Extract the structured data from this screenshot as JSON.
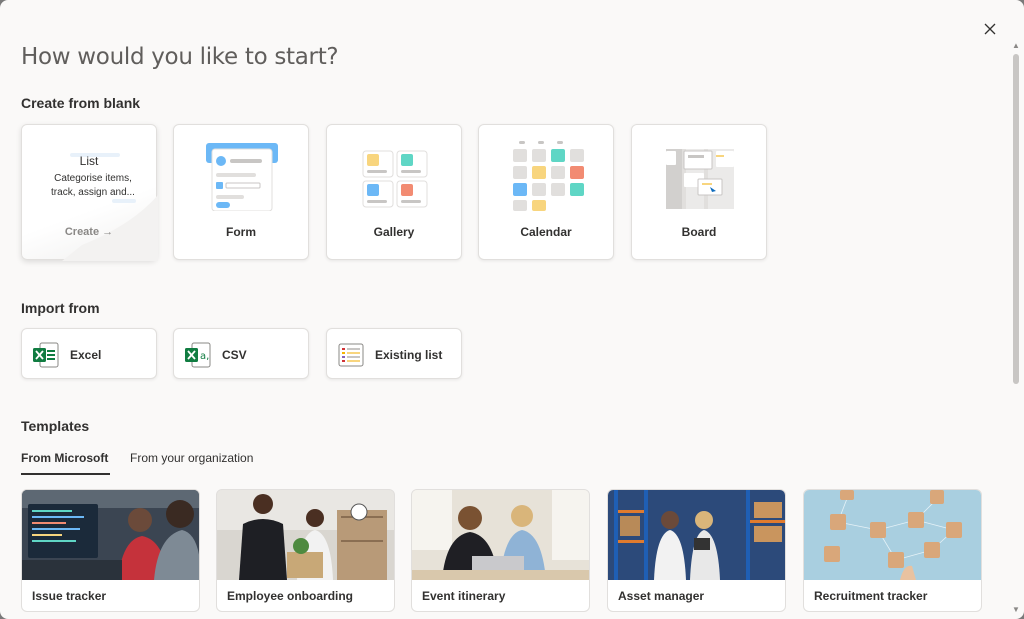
{
  "dialog": {
    "title": "How would you like to start?",
    "close_icon": "close-icon"
  },
  "create_blank": {
    "heading": "Create from blank",
    "list": {
      "title": "List",
      "description": "Categorise items, track, assign and...",
      "create_label": "Create →"
    },
    "cards": [
      {
        "label": "Form",
        "icon": "form-icon"
      },
      {
        "label": "Gallery",
        "icon": "gallery-icon"
      },
      {
        "label": "Calendar",
        "icon": "calendar-icon"
      },
      {
        "label": "Board",
        "icon": "board-icon"
      }
    ]
  },
  "import_from": {
    "heading": "Import from",
    "items": [
      {
        "label": "Excel",
        "icon": "excel-icon"
      },
      {
        "label": "CSV",
        "icon": "csv-icon"
      },
      {
        "label": "Existing list",
        "icon": "existing-list-icon"
      }
    ]
  },
  "templates": {
    "heading": "Templates",
    "tabs": [
      {
        "label": "From Microsoft",
        "active": true
      },
      {
        "label": "From your organization",
        "active": false
      }
    ],
    "items": [
      {
        "label": "Issue tracker",
        "image": "developers-at-screens-photo"
      },
      {
        "label": "Employee onboarding",
        "image": "handshake-office-photo"
      },
      {
        "label": "Event itinerary",
        "image": "women-laptop-photo"
      },
      {
        "label": "Asset manager",
        "image": "warehouse-photo"
      },
      {
        "label": "Recruitment tracker",
        "image": "network-blocks-photo"
      }
    ]
  },
  "colors": {
    "background": "#faf9f8",
    "text": "#323130",
    "muted": "#605e5c",
    "accent": "#0f6cbd"
  }
}
